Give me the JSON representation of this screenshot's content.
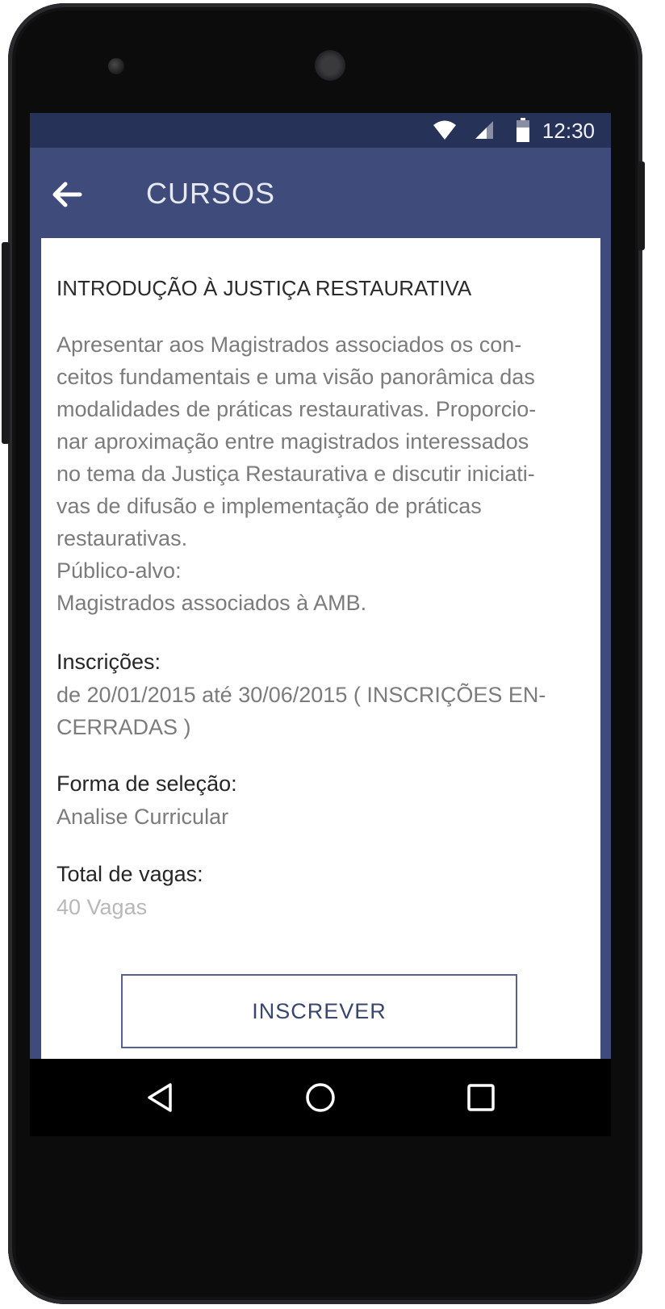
{
  "status_bar": {
    "time": "12:30",
    "icons": [
      "wifi-icon",
      "cellular-signal-icon",
      "battery-icon"
    ]
  },
  "app_bar": {
    "title": "CURSOS",
    "back_icon": "arrow-left-icon"
  },
  "course": {
    "title": "INTRODUÇÃO À JUSTIÇA RESTAURATIVA",
    "description_lines": [
      "Apresentar aos Magistrados associados os con-",
      "ceitos fundamentais e uma visão panorâmica das",
      "modalidades de práticas restaurativas. Proporcio-",
      "nar aproximação entre magistrados interessados",
      "no tema da Justiça Restaurativa e discutir iniciati-",
      "vas de difusão e implementação de práticas",
      "restaurativas.",
      "Público-alvo:",
      "Magistrados associados à AMB."
    ],
    "inscricoes_label": "Inscrições:",
    "inscricoes_value_lines": [
      "de 20/01/2015 até 30/06/2015 ( INSCRIÇÕES EN-",
      "CERRADAS )"
    ],
    "selecao_label": "Forma de seleção:",
    "selecao_value": "Analise Curricular",
    "vagas_label": "Total de vagas:",
    "vagas_value": "40 Vagas"
  },
  "actions": {
    "subscribe_label": "INSCREVER"
  },
  "navigation": {
    "buttons": [
      "back-triangle-icon",
      "home-circle-icon",
      "recents-square-icon"
    ]
  },
  "colors": {
    "status_bar": "#273259",
    "app_bar": "#3f4b7a",
    "button_border": "#56618d"
  }
}
